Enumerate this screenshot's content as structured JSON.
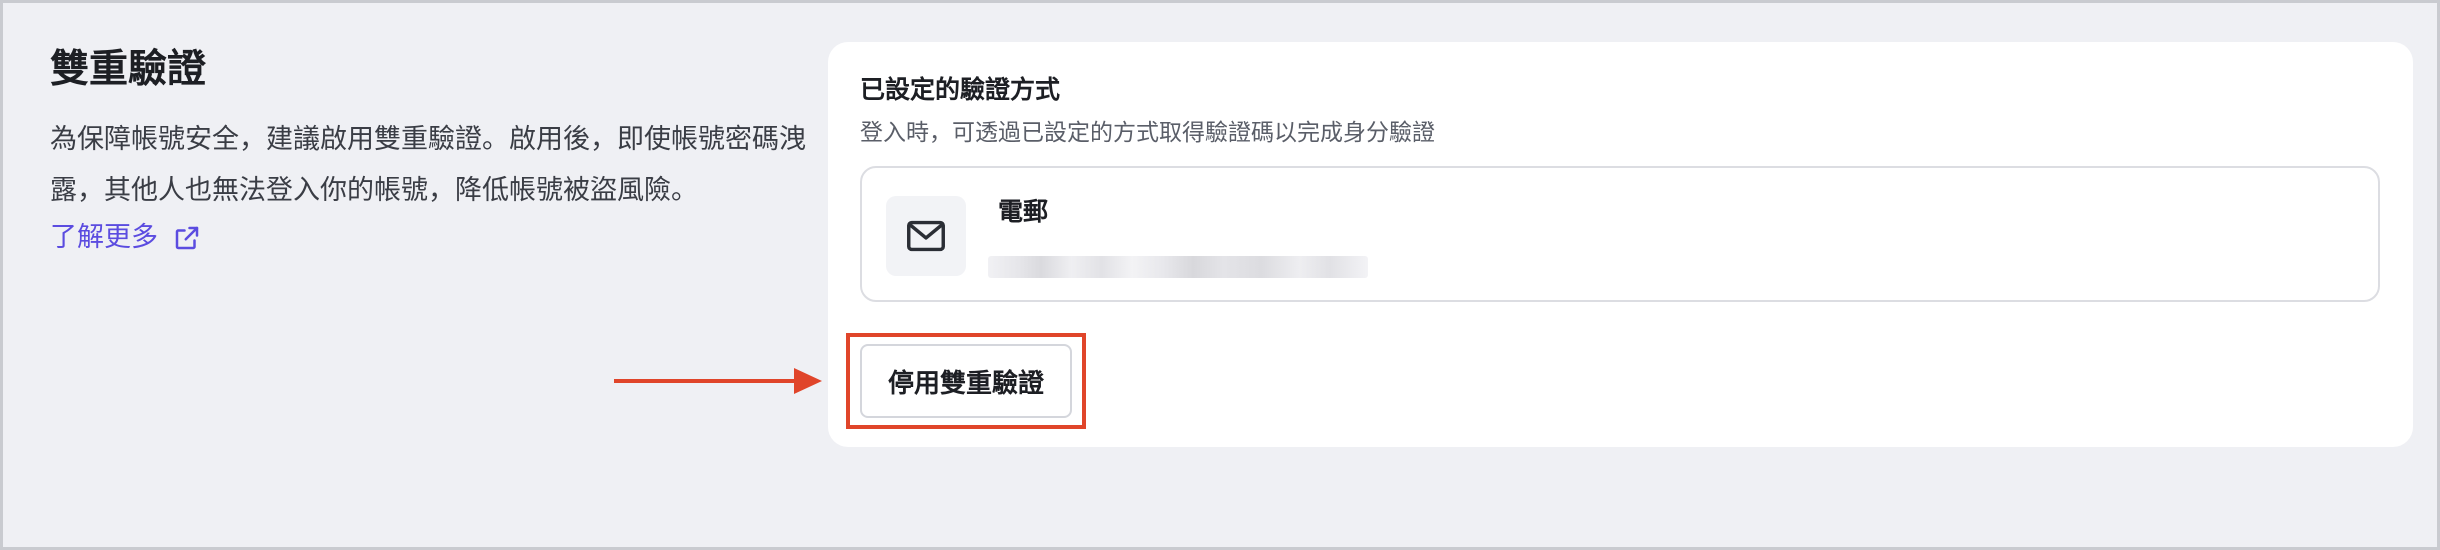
{
  "section": {
    "title": "雙重驗證",
    "description": "為保障帳號安全，建議啟用雙重驗證。啟用後，即使帳號密碼洩露，其他人也無法登入你的帳號，降低帳號被盜風險。",
    "learn_more_label": "了解更多",
    "learn_more_icon": "external-link-icon"
  },
  "card": {
    "title": "已設定的驗證方式",
    "subtitle": "登入時，可透過已設定的方式取得驗證碼以完成身分驗證",
    "method": {
      "icon": "mail-icon",
      "label": "電郵"
    },
    "disable_button_label": "停用雙重驗證"
  },
  "annotation": {
    "arrow_color": "#e0452a",
    "highlight_color": "#e0452a"
  },
  "colors": {
    "background": "#eff0f4",
    "card": "#ffffff",
    "link": "#5b4ce0"
  }
}
